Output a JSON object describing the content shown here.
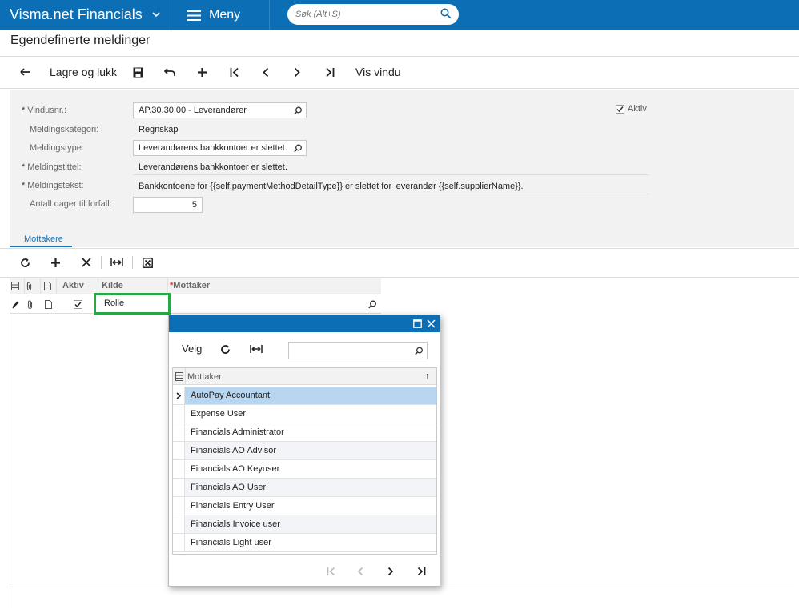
{
  "app": {
    "title": "Visma.net Financials",
    "menu_label": "Meny",
    "search_placeholder": "Søk (Alt+S)"
  },
  "page": {
    "title": "Egendefinerte meldinger"
  },
  "toolbar": {
    "back_icon": "arrow-left-icon",
    "save_close_label": "Lagre og lukk",
    "save_icon": "floppy-disk-icon",
    "undo_icon": "undo-icon",
    "add_icon": "plus-icon",
    "first_icon": "first-page-icon",
    "prev_icon": "chevron-left-icon",
    "next_icon": "chevron-right-icon",
    "last_icon": "last-page-icon",
    "vis_vindu_label": "Vis vindu"
  },
  "form": {
    "vindusnr": {
      "label": "Vindusnr.:",
      "value": "AP.30.30.00 - Leverandører"
    },
    "meldingskategori": {
      "label": "Meldingskategori:",
      "value": "Regnskap"
    },
    "meldingstype": {
      "label": "Meldingstype:",
      "value": "Leverandørens bankkontoer er slettet."
    },
    "meldingstittel": {
      "label": "Meldingstittel:",
      "value": "Leverandørens bankkontoer er slettet."
    },
    "meldingstekst": {
      "label": "Meldingstekst:",
      "value": "Bankkontoene for {{self.paymentMethodDetailType}} er slettet for leverandør {{self.supplierName}}."
    },
    "antall_dager": {
      "label": "Antall dager til forfall:",
      "value": "5"
    },
    "aktiv": {
      "label": "Aktiv",
      "checked": true
    }
  },
  "tabs": [
    {
      "label": "Mottakere"
    }
  ],
  "grid_toolbar": {
    "icons": [
      "refresh-icon",
      "plus-icon",
      "close-icon",
      "fit-columns-icon",
      "export-excel-icon"
    ]
  },
  "grid": {
    "columns": [
      "Aktiv",
      "Kilde",
      "Mottaker"
    ],
    "required_marker": "*",
    "rows": [
      {
        "aktiv": true,
        "kilde": "Rolle",
        "mottaker": ""
      }
    ]
  },
  "popup": {
    "select_label": "Velg",
    "column_header": "Mottaker",
    "sort_indicator": "↑",
    "rows": [
      "AutoPay Accountant",
      "Expense User",
      "Financials Administrator",
      "Financials AO Advisor",
      "Financials AO Keyuser",
      "Financials AO User",
      "Financials Entry User",
      "Financials Invoice user",
      "Financials Light user"
    ],
    "selected_index": 0
  },
  "colors": {
    "brand": "#0c6fb5",
    "highlight": "#27a745",
    "selected_row": "#b8d6f0"
  }
}
